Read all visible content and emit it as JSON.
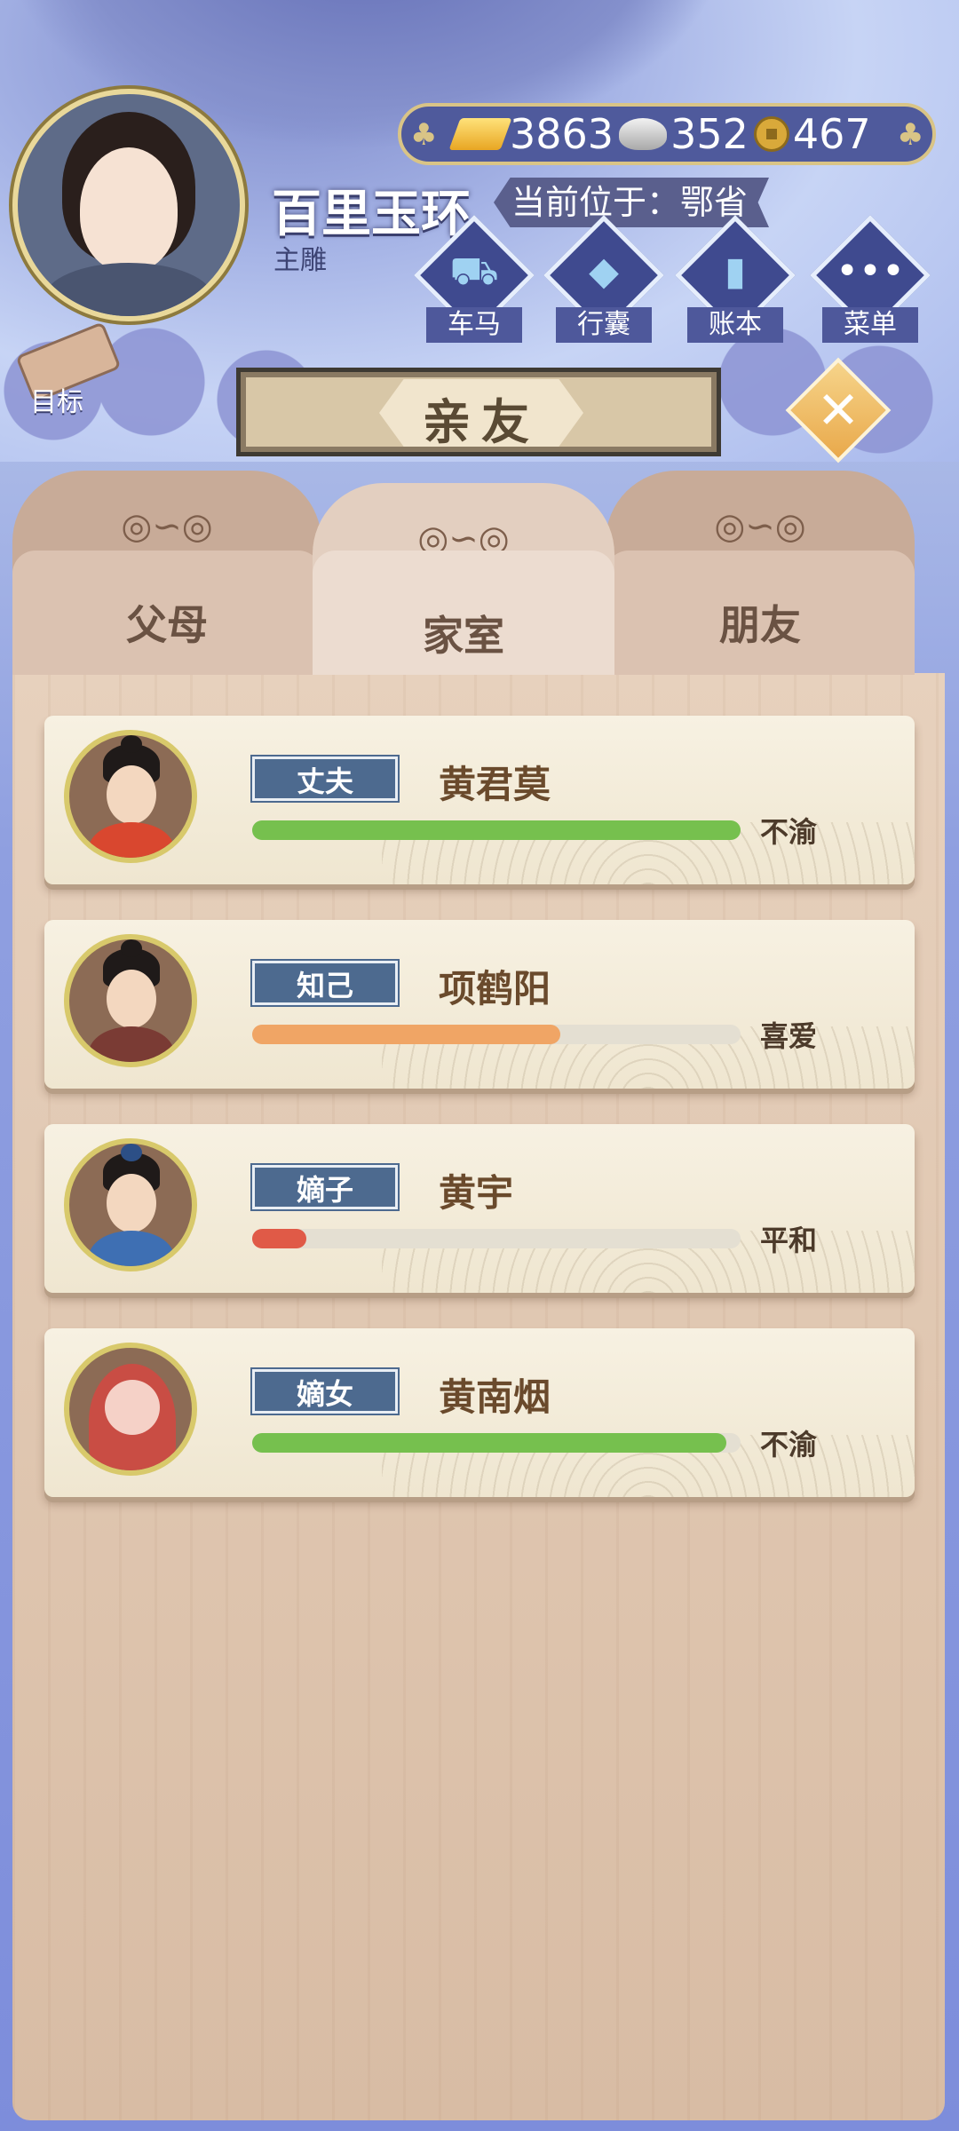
{
  "player": {
    "name": "百里玉环",
    "title": "主雕",
    "location": "当前位于：鄂省"
  },
  "currency": {
    "gold": "3863",
    "silver": "352",
    "copper": "467"
  },
  "menu_buttons": [
    {
      "label": "车马",
      "icon": "carriage-icon"
    },
    {
      "label": "行囊",
      "icon": "bag-icon"
    },
    {
      "label": "账本",
      "icon": "ledger-icon"
    },
    {
      "label": "菜单",
      "icon": "more-icon"
    }
  ],
  "goal": {
    "label": "目标"
  },
  "dialog": {
    "title": "亲友"
  },
  "tabs": [
    {
      "label": "父母",
      "active": false
    },
    {
      "label": "家室",
      "active": true
    },
    {
      "label": "朋友",
      "active": false
    }
  ],
  "members": [
    {
      "relation": "丈夫",
      "name": "黄君莫",
      "mood": "不渝",
      "affinity_pct": 100,
      "bar_color": "#76c04e"
    },
    {
      "relation": "知己",
      "name": "项鹤阳",
      "mood": "喜爱",
      "affinity_pct": 63,
      "bar_color": "#f0a565"
    },
    {
      "relation": "嫡子",
      "name": "黄宇",
      "mood": "平和",
      "affinity_pct": 11,
      "bar_color": "#e05a47"
    },
    {
      "relation": "嫡女",
      "name": "黄南烟",
      "mood": "不渝",
      "affinity_pct": 97,
      "bar_color": "#76c04e"
    }
  ]
}
